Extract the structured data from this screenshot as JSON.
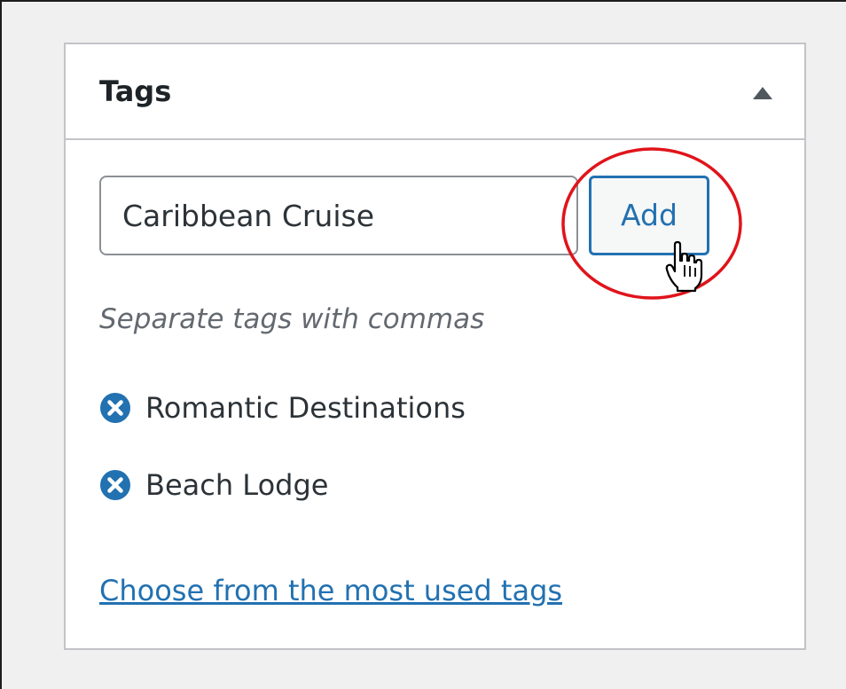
{
  "panel": {
    "title": "Tags",
    "toggle_icon": "triangle-up-icon"
  },
  "tag_input": {
    "value": "Caribbean Cruise"
  },
  "add_button": {
    "label": "Add"
  },
  "hint": "Separate tags with commas",
  "tags": [
    {
      "label": "Romantic Destinations",
      "icon": "remove-circle-icon"
    },
    {
      "label": "Beach Lodge",
      "icon": "remove-circle-icon"
    }
  ],
  "most_used_link": "Choose from the most used tags",
  "colors": {
    "accent": "#2271b1",
    "highlight_circle": "#e0141b",
    "border": "#c3c4c7",
    "text": "#2c3338",
    "muted": "#646970"
  }
}
